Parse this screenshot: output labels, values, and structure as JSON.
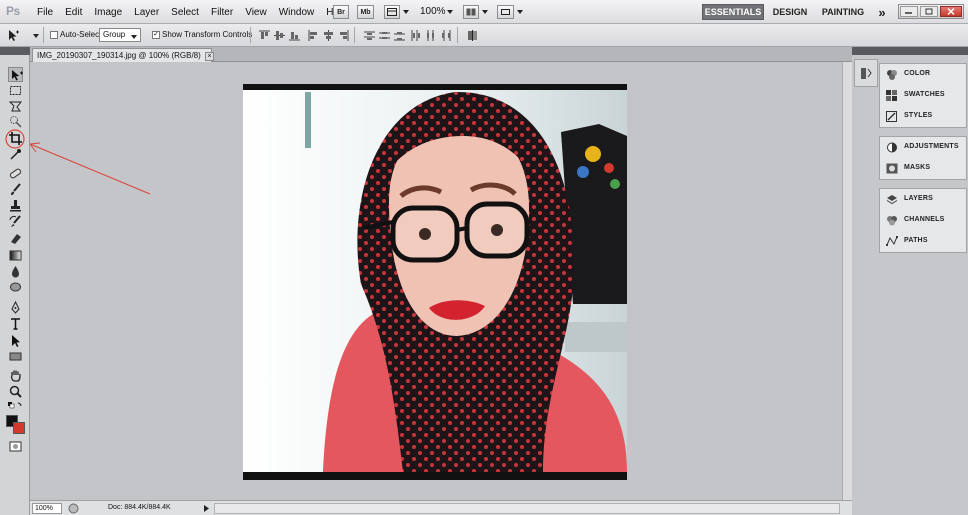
{
  "app": {
    "logo": "Ps"
  },
  "menu": [
    "File",
    "Edit",
    "Image",
    "Layer",
    "Select",
    "Filter",
    "View",
    "Window",
    "Help"
  ],
  "app_bar": {
    "bridge_label": "Br",
    "minibridge_label": "Mb",
    "zoom": "100%"
  },
  "workspaces": [
    "ESSENTIALS",
    "DESIGN",
    "PAINTING"
  ],
  "workspace_more": "»",
  "options": {
    "auto_select_label": "Auto-Select:",
    "auto_select_value": "Group",
    "show_transform_label": "Show Transform Controls",
    "show_transform_checked": true
  },
  "document": {
    "tab_title": "IMG_20190307_190314.jpg @ 100% (RGB/8)",
    "close_glyph": "×"
  },
  "status": {
    "zoom": "100%",
    "doc_size": "Doc: 884.4K/884.4K"
  },
  "panels": {
    "group1": [
      "COLOR",
      "SWATCHES",
      "STYLES"
    ],
    "group2": [
      "ADJUSTMENTS",
      "MASKS"
    ],
    "group3": [
      "LAYERS",
      "CHANNELS",
      "PATHS"
    ]
  },
  "colors": {
    "foreground": "#111111",
    "background": "#d23a2b",
    "annotation": "#d9453b",
    "essentials_active": "#727377"
  }
}
